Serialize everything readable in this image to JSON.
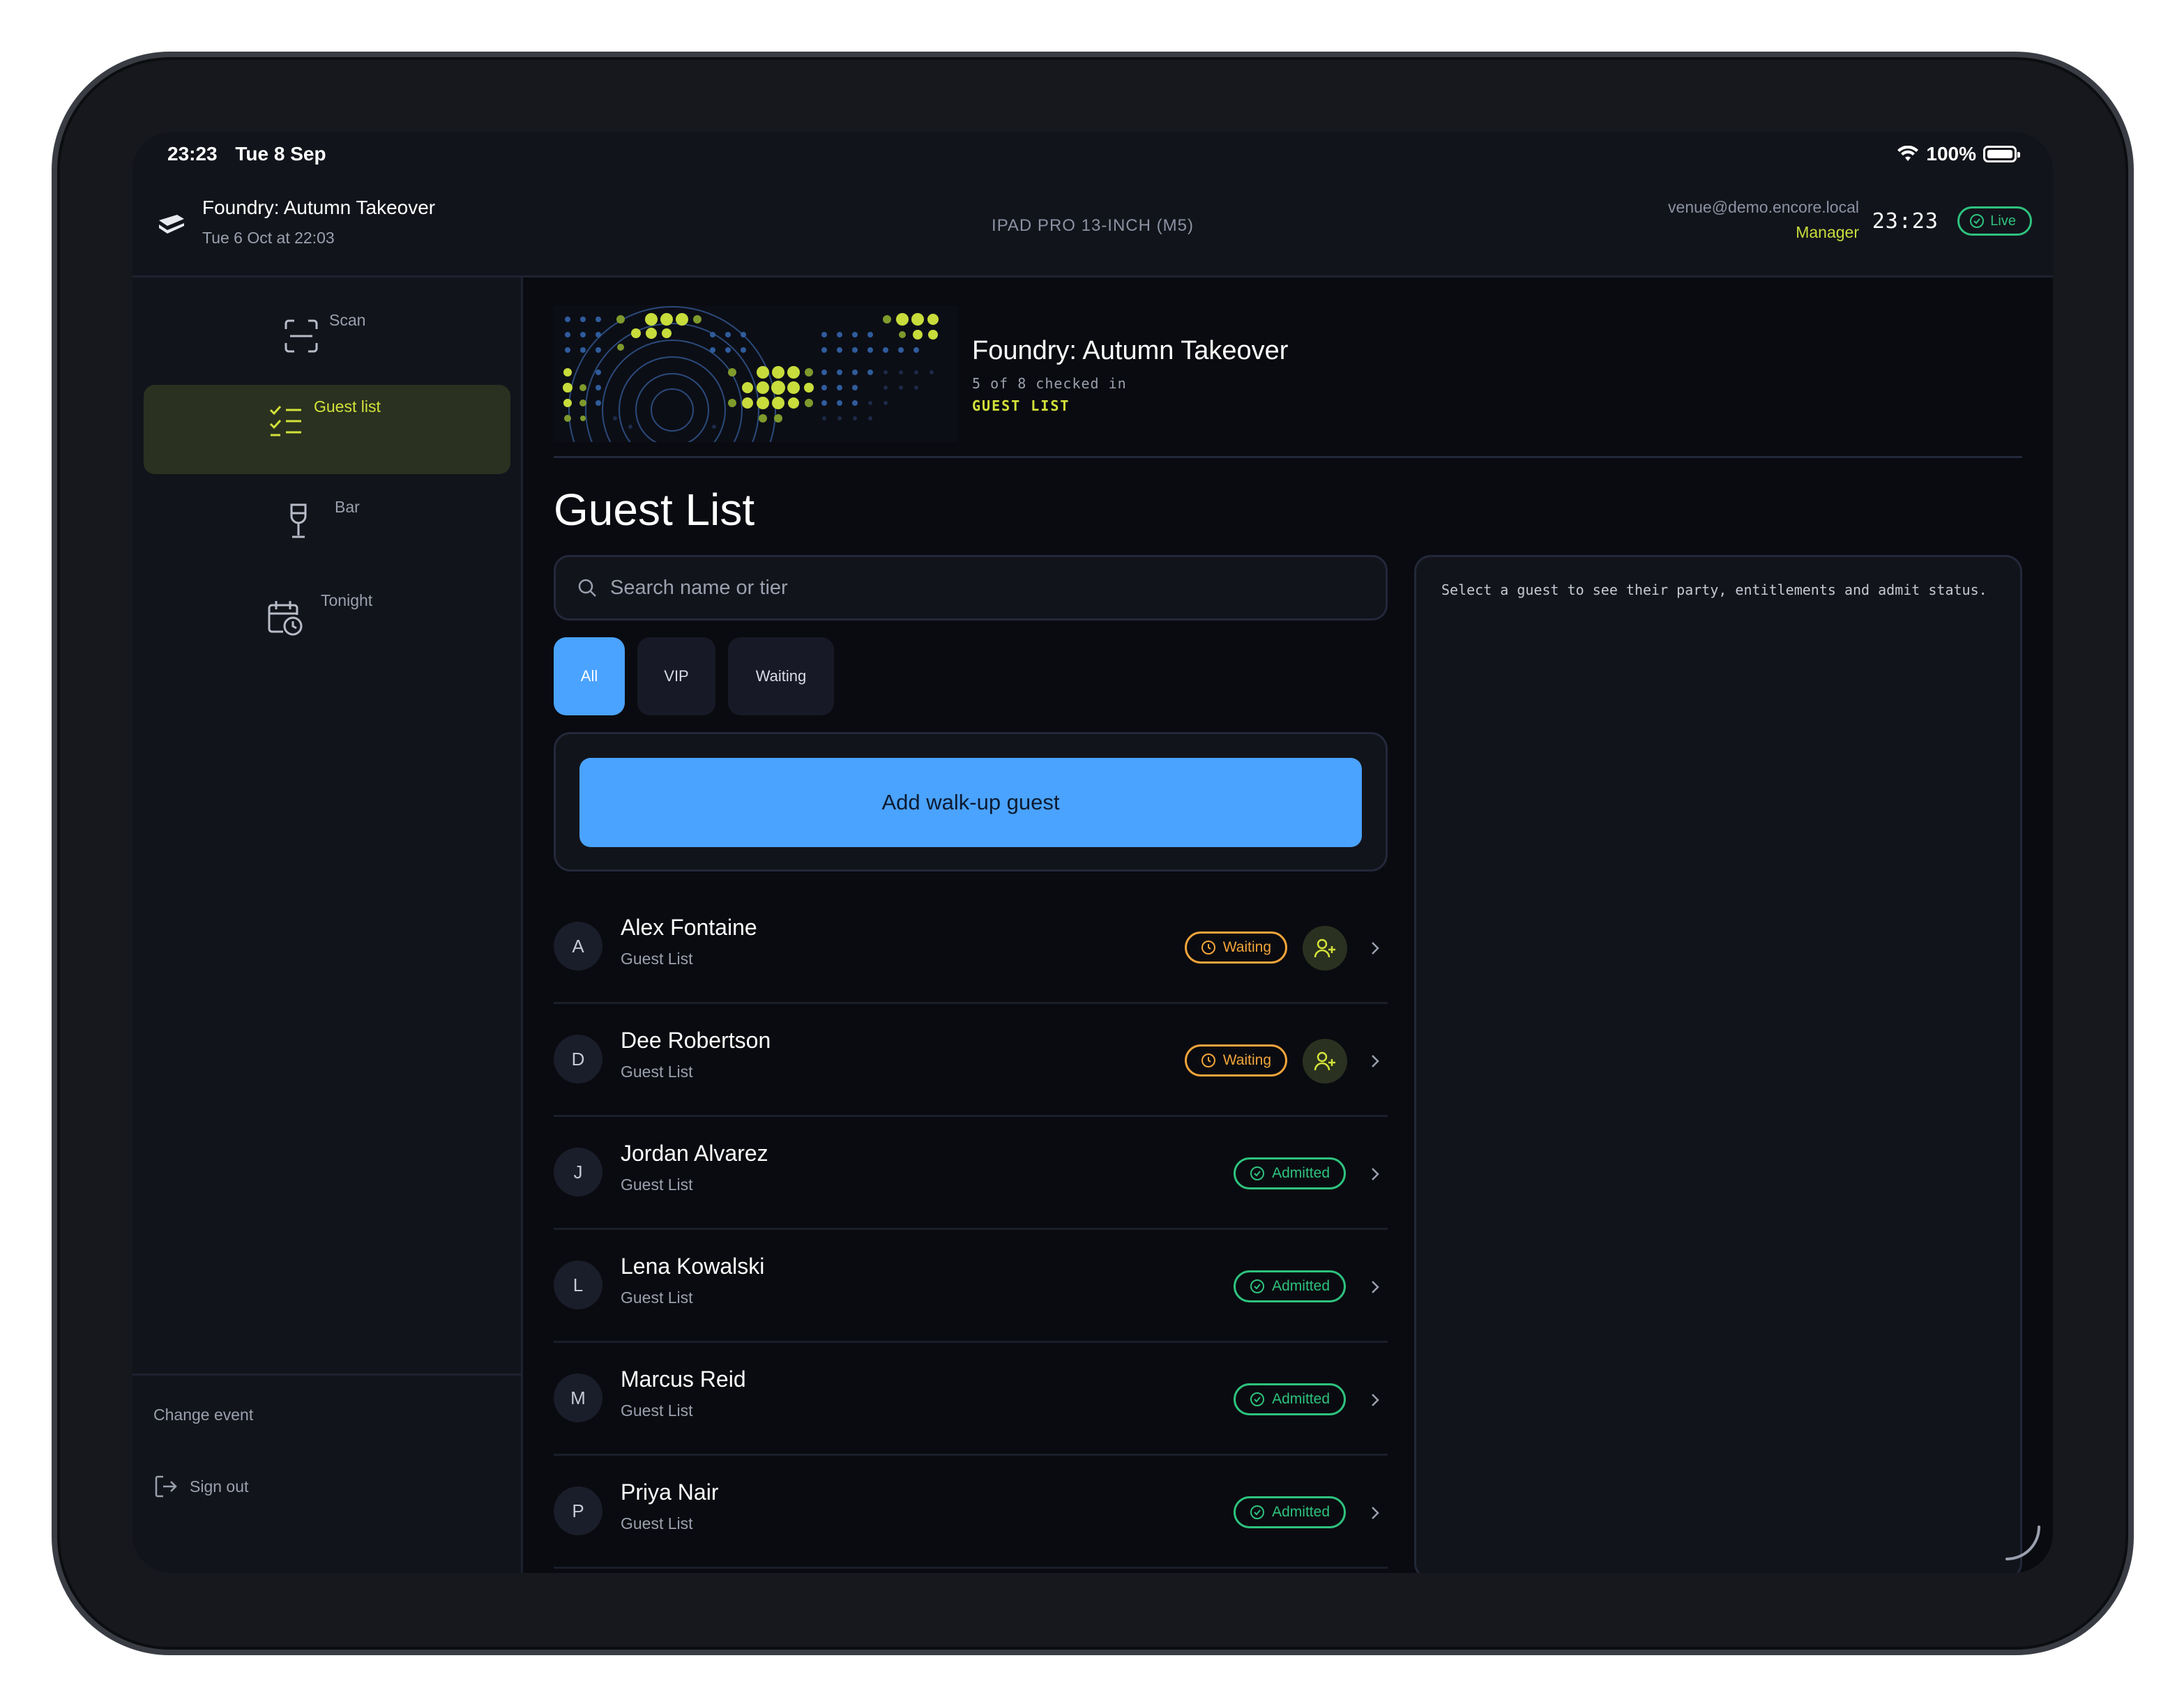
{
  "status_bar": {
    "time": "23:23",
    "date": "Tue 8 Sep",
    "battery": "100%"
  },
  "header": {
    "event_name": "Foundry: Autumn Takeover",
    "event_date": "Tue 6 Oct at 22:03",
    "device_label": "IPAD PRO 13-INCH (M5)",
    "user_email": "venue@demo.encore.local",
    "user_role": "Manager",
    "clock": "23:23",
    "live_label": "Live"
  },
  "sidebar": {
    "items": [
      {
        "label": "Scan",
        "icon": "scan-icon",
        "active": false
      },
      {
        "label": "Guest list",
        "icon": "checklist-icon",
        "active": true
      },
      {
        "label": "Bar",
        "icon": "wine-glass-icon",
        "active": false
      },
      {
        "label": "Tonight",
        "icon": "calendar-clock-icon",
        "active": false
      }
    ],
    "change_event": "Change event",
    "sign_out": "Sign out"
  },
  "hero": {
    "title": "Foundry: Autumn Takeover",
    "checked_in": "5 of 8 checked in",
    "tag": "GUEST LIST"
  },
  "page_title": "Guest List",
  "search": {
    "placeholder": "Search name or tier",
    "value": ""
  },
  "filters": [
    {
      "label": "All",
      "active": true
    },
    {
      "label": "VIP",
      "active": false
    },
    {
      "label": "Waiting",
      "active": false
    }
  ],
  "walkup_button": "Add walk-up guest",
  "guests": [
    {
      "initial": "A",
      "name": "Alex Fontaine",
      "tier": "Guest List",
      "status": "Waiting"
    },
    {
      "initial": "D",
      "name": "Dee Robertson",
      "tier": "Guest List",
      "status": "Waiting"
    },
    {
      "initial": "J",
      "name": "Jordan Alvarez",
      "tier": "Guest List",
      "status": "Admitted"
    },
    {
      "initial": "L",
      "name": "Lena Kowalski",
      "tier": "Guest List",
      "status": "Admitted"
    },
    {
      "initial": "M",
      "name": "Marcus Reid",
      "tier": "Guest List",
      "status": "Admitted"
    },
    {
      "initial": "P",
      "name": "Priya Nair",
      "tier": "Guest List",
      "status": "Admitted"
    }
  ],
  "detail_hint": "Select a guest to see their party, entitlements and admit status.",
  "colors": {
    "accent_blue": "#4aa3ff",
    "accent_lime": "#d3e23a",
    "admitted_green": "#2ec27e",
    "waiting_amber": "#f0a43a",
    "background": "#0a0b10"
  }
}
